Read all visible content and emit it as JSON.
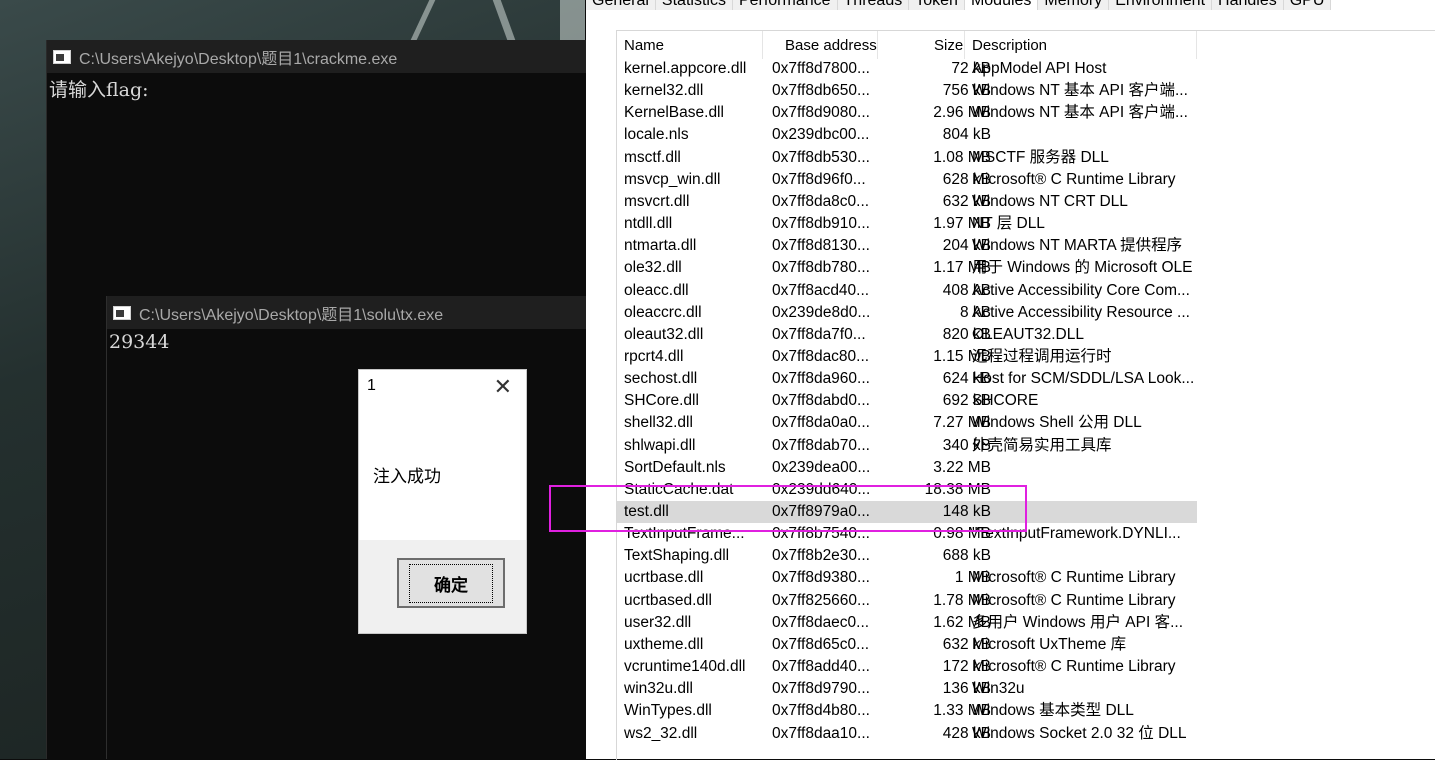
{
  "console1": {
    "title": "C:\\Users\\Akejyo\\Desktop\\题目1\\crackme.exe",
    "output": "请输入flag:"
  },
  "console2": {
    "title": "C:\\Users\\Akejyo\\Desktop\\题目1\\solu\\tx.exe",
    "output": "29344"
  },
  "msgbox": {
    "title": "1",
    "close": "✕",
    "message": "注入成功",
    "button": "确定"
  },
  "tabs": [
    "General",
    "Statistics",
    "Performance",
    "Threads",
    "Token",
    "Modules",
    "Memory",
    "Environment",
    "Handles",
    "GPU"
  ],
  "active_tab": "Modules",
  "columns": {
    "name": "Name",
    "base": "Base address",
    "size": "Size",
    "desc": "Description"
  },
  "modules": [
    {
      "name": "kernel.appcore.dll",
      "base": "0x7ff8d7800...",
      "size": "72 kB",
      "desc": "AppModel API Host"
    },
    {
      "name": "kernel32.dll",
      "base": "0x7ff8db650...",
      "size": "756 kB",
      "desc": "Windows NT 基本 API 客户端..."
    },
    {
      "name": "KernelBase.dll",
      "base": "0x7ff8d9080...",
      "size": "2.96 MB",
      "desc": "Windows NT 基本 API 客户端..."
    },
    {
      "name": "locale.nls",
      "base": "0x239dbc00...",
      "size": "804 kB",
      "desc": ""
    },
    {
      "name": "msctf.dll",
      "base": "0x7ff8db530...",
      "size": "1.08 MB",
      "desc": "MSCTF 服务器 DLL"
    },
    {
      "name": "msvcp_win.dll",
      "base": "0x7ff8d96f0...",
      "size": "628 kB",
      "desc": "Microsoft® C Runtime Library"
    },
    {
      "name": "msvcrt.dll",
      "base": "0x7ff8da8c0...",
      "size": "632 kB",
      "desc": "Windows NT CRT DLL"
    },
    {
      "name": "ntdll.dll",
      "base": "0x7ff8db910...",
      "size": "1.97 MB",
      "desc": "NT 层 DLL"
    },
    {
      "name": "ntmarta.dll",
      "base": "0x7ff8d8130...",
      "size": "204 kB",
      "desc": "Windows NT MARTA 提供程序"
    },
    {
      "name": "ole32.dll",
      "base": "0x7ff8db780...",
      "size": "1.17 MB",
      "desc": "用于 Windows 的 Microsoft OLE"
    },
    {
      "name": "oleacc.dll",
      "base": "0x7ff8acd40...",
      "size": "408 kB",
      "desc": "Active Accessibility Core Com..."
    },
    {
      "name": "oleaccrc.dll",
      "base": "0x239de8d0...",
      "size": "8 kB",
      "desc": "Active Accessibility Resource ..."
    },
    {
      "name": "oleaut32.dll",
      "base": "0x7ff8da7f0...",
      "size": "820 kB",
      "desc": "OLEAUT32.DLL"
    },
    {
      "name": "rpcrt4.dll",
      "base": "0x7ff8dac80...",
      "size": "1.15 MB",
      "desc": "远程过程调用运行时"
    },
    {
      "name": "sechost.dll",
      "base": "0x7ff8da960...",
      "size": "624 kB",
      "desc": "Host for SCM/SDDL/LSA Look..."
    },
    {
      "name": "SHCore.dll",
      "base": "0x7ff8dabd0...",
      "size": "692 kB",
      "desc": "SHCORE"
    },
    {
      "name": "shell32.dll",
      "base": "0x7ff8da0a0...",
      "size": "7.27 MB",
      "desc": "Windows Shell 公用 DLL"
    },
    {
      "name": "shlwapi.dll",
      "base": "0x7ff8dab70...",
      "size": "340 kB",
      "desc": "外壳简易实用工具库"
    },
    {
      "name": "SortDefault.nls",
      "base": "0x239dea00...",
      "size": "3.22 MB",
      "desc": ""
    },
    {
      "name": "StaticCache.dat",
      "base": "0x239dd640...",
      "size": "18.38 MB",
      "desc": ""
    },
    {
      "name": "test.dll",
      "base": "0x7ff8979a0...",
      "size": "148 kB",
      "desc": ""
    },
    {
      "name": "TextInputFrame...",
      "base": "0x7ff8b7540...",
      "size": "0.98 MB",
      "desc": "\"TextInputFramework.DYNLI..."
    },
    {
      "name": "TextShaping.dll",
      "base": "0x7ff8b2e30...",
      "size": "688 kB",
      "desc": ""
    },
    {
      "name": "ucrtbase.dll",
      "base": "0x7ff8d9380...",
      "size": "1 MB",
      "desc": "Microsoft® C Runtime Library"
    },
    {
      "name": "ucrtbased.dll",
      "base": "0x7ff825660...",
      "size": "1.78 MB",
      "desc": "Microsoft® C Runtime Library"
    },
    {
      "name": "user32.dll",
      "base": "0x7ff8daec0...",
      "size": "1.62 MB",
      "desc": "多用户 Windows 用户 API 客..."
    },
    {
      "name": "uxtheme.dll",
      "base": "0x7ff8d65c0...",
      "size": "632 kB",
      "desc": "Microsoft UxTheme 库"
    },
    {
      "name": "vcruntime140d.dll",
      "base": "0x7ff8add40...",
      "size": "172 kB",
      "desc": "Microsoft® C Runtime Library"
    },
    {
      "name": "win32u.dll",
      "base": "0x7ff8d9790...",
      "size": "136 kB",
      "desc": "Win32u"
    },
    {
      "name": "WinTypes.dll",
      "base": "0x7ff8d4b80...",
      "size": "1.33 MB",
      "desc": "Windows 基本类型 DLL"
    },
    {
      "name": "ws2_32.dll",
      "base": "0x7ff8daa10...",
      "size": "428 kB",
      "desc": "Windows Socket 2.0 32 位 DLL"
    }
  ],
  "selected_module": "test.dll",
  "highlight_color": "#e020e0"
}
